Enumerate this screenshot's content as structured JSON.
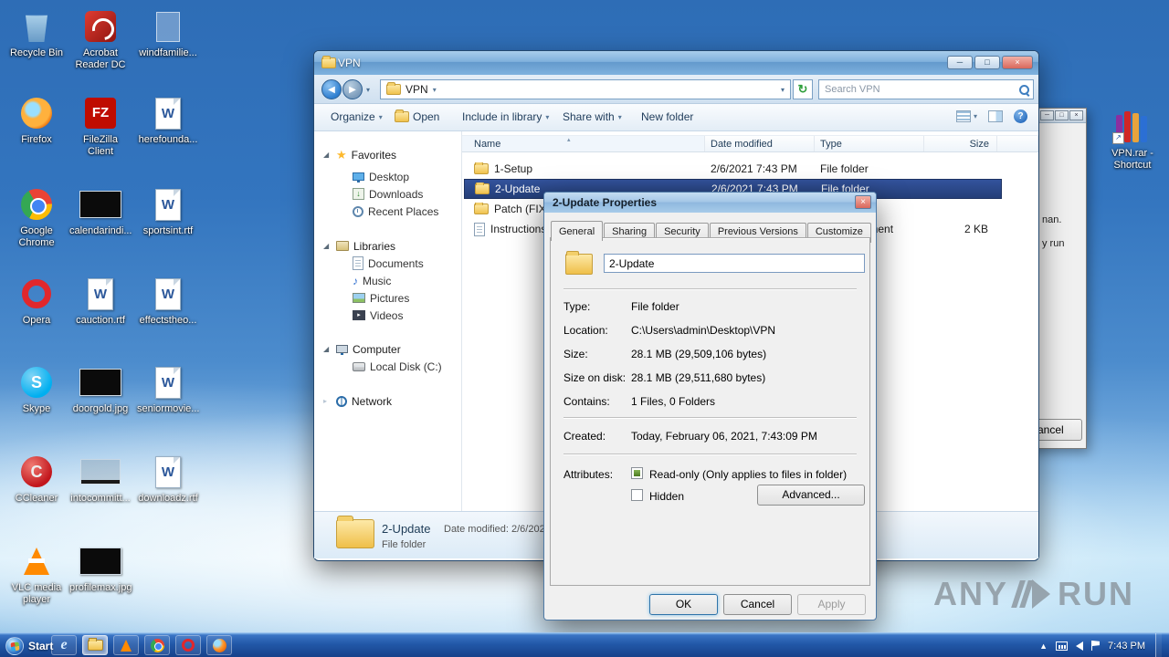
{
  "desktop": {
    "col1": [
      "Recycle Bin",
      "Firefox",
      "Google Chrome",
      "Opera",
      "Skype",
      "CCleaner",
      "VLC media player"
    ],
    "col2": [
      "Acrobat Reader DC",
      "FileZilla Client",
      "calendarindi...",
      "cauction.rtf",
      "doorgold.jpg",
      "intocommitt...",
      "profilemax.jpg"
    ],
    "col3": [
      "windfamilie...",
      "herefounda...",
      "sportsint.rtf",
      "effectstheo...",
      "seniormovie...",
      "downloadz.rtf"
    ],
    "right_icon": "VPN.rar - Shortcut"
  },
  "explorer": {
    "title": "VPN",
    "breadcrumb": "VPN",
    "search_placeholder": "Search VPN",
    "toolbar": {
      "organize": "Organize",
      "open": "Open",
      "include": "Include in library",
      "share": "Share with",
      "new_folder": "New folder"
    },
    "columns": {
      "name": "Name",
      "date": "Date modified",
      "type": "Type",
      "size": "Size"
    },
    "rows": [
      {
        "name": "1-Setup",
        "date": "2/6/2021 7:43 PM",
        "type": "File folder",
        "size": ""
      },
      {
        "name": "2-Update",
        "date": "2/6/2021 7:43 PM",
        "type": "File folder",
        "size": ""
      },
      {
        "name": "Patch (FIX)",
        "date": "",
        "type": "",
        "size": ""
      },
      {
        "name": "Instructions",
        "date": "",
        "type": "Text Document",
        "size": "2 KB"
      }
    ],
    "nav": {
      "favorites": "Favorites",
      "desktop": "Desktop",
      "downloads": "Downloads",
      "recent": "Recent Places",
      "libraries": "Libraries",
      "documents": "Documents",
      "music": "Music",
      "pictures": "Pictures",
      "videos": "Videos",
      "computer": "Computer",
      "disk": "Local Disk (C:)",
      "network": "Network"
    },
    "details": {
      "name": "2-Update",
      "modified": "Date modified: 2/6/2021 7:43 PM",
      "type": "File folder"
    }
  },
  "properties": {
    "title": "2-Update Properties",
    "tabs": [
      "General",
      "Sharing",
      "Security",
      "Previous Versions",
      "Customize"
    ],
    "name_value": "2-Update",
    "fields": [
      {
        "label": "Type:",
        "value": "File folder"
      },
      {
        "label": "Location:",
        "value": "C:\\Users\\admin\\Desktop\\VPN"
      },
      {
        "label": "Size:",
        "value": "28.1 MB (29,509,106 bytes)"
      },
      {
        "label": "Size on disk:",
        "value": "28.1 MB (29,511,680 bytes)"
      },
      {
        "label": "Contains:",
        "value": "1 Files, 0 Folders"
      }
    ],
    "created_label": "Created:",
    "created_value": "Today, February 06, 2021, 7:43:09 PM",
    "attributes_label": "Attributes:",
    "readonly_label": "Read-only (Only applies to files in folder)",
    "hidden_label": "Hidden",
    "advanced": "Advanced...",
    "ok": "OK",
    "cancel": "Cancel",
    "apply": "Apply"
  },
  "partial_window": {
    "line1": "nan.",
    "line2": "y run",
    "cancel": "Cancel"
  },
  "taskbar": {
    "start": "Start",
    "clock": "7:43 PM"
  },
  "watermark": {
    "any": "ANY",
    "run": "RUN"
  }
}
